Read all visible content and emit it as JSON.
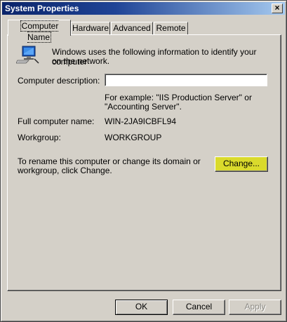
{
  "window": {
    "title": "System Properties",
    "close_glyph": "×"
  },
  "tabs": [
    {
      "label": "Computer Name",
      "active": true
    },
    {
      "label": "Hardware",
      "active": false
    },
    {
      "label": "Advanced",
      "active": false
    },
    {
      "label": "Remote",
      "active": false
    }
  ],
  "computer_name": {
    "intro_line1": "Windows uses the following information to identify your computer",
    "intro_line2": "on the network.",
    "description_label": "Computer description:",
    "description_value": "",
    "example_line1": "For example: \"IIS Production Server\" or",
    "example_line2": "\"Accounting Server\".",
    "full_name_label": "Full computer name:",
    "full_name_value": "WIN-2JA9ICBFL94",
    "workgroup_label": "Workgroup:",
    "workgroup_value": "WORKGROUP",
    "rename_line1": "To rename this computer or change its domain or",
    "rename_line2": "workgroup, click Change.",
    "change_label": "Change..."
  },
  "footer": {
    "ok_label": "OK",
    "cancel_label": "Cancel",
    "apply_label": "Apply",
    "apply_enabled": false
  },
  "colors": {
    "title_bar": "#0a246a",
    "face": "#d4d0c8",
    "change_highlight": "#dada2c"
  },
  "icons": {
    "computer": "computer-network-icon",
    "close": "close-icon"
  }
}
